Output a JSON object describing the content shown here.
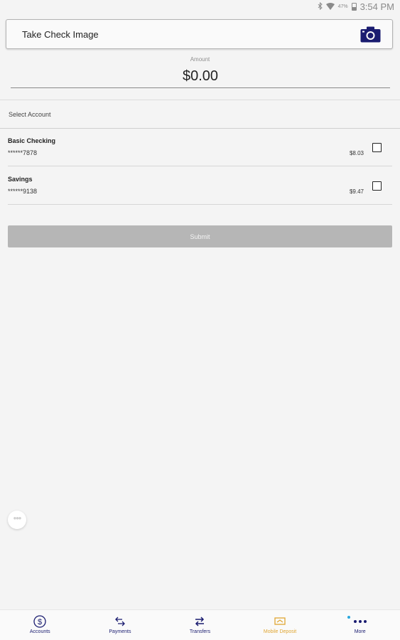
{
  "status_bar": {
    "icons": [
      "bluetooth-icon",
      "wifi-icon",
      "battery-icon"
    ],
    "battery_percent": "47%",
    "time": "3:54 PM"
  },
  "take_check": {
    "label": "Take Check Image",
    "icon": "camera-icon"
  },
  "amount": {
    "caption": "Amount",
    "value": "$0.00"
  },
  "select_account_label": "Select Account",
  "accounts": [
    {
      "name": "Basic Checking",
      "number": "******7878",
      "balance": "$8.03",
      "checked": false
    },
    {
      "name": "Savings",
      "number": "******9138",
      "balance": "$9.47",
      "checked": false
    }
  ],
  "submit_label": "Submit",
  "bottom_nav": {
    "items": [
      {
        "label": "Accounts",
        "icon": "dollar-circle-icon"
      },
      {
        "label": "Payments",
        "icon": "payments-icon"
      },
      {
        "label": "Transfers",
        "icon": "transfer-arrows-icon"
      },
      {
        "label": "Mobile Deposit",
        "icon": "mobile-deposit-icon",
        "active": true
      },
      {
        "label": "More",
        "icon": "more-dots-icon"
      }
    ]
  },
  "colors": {
    "brand": "#1a1c70",
    "active_tab": "#e0a633",
    "submit_disabled": "#b6b6b6",
    "badge_dot": "#2aa7dd"
  }
}
